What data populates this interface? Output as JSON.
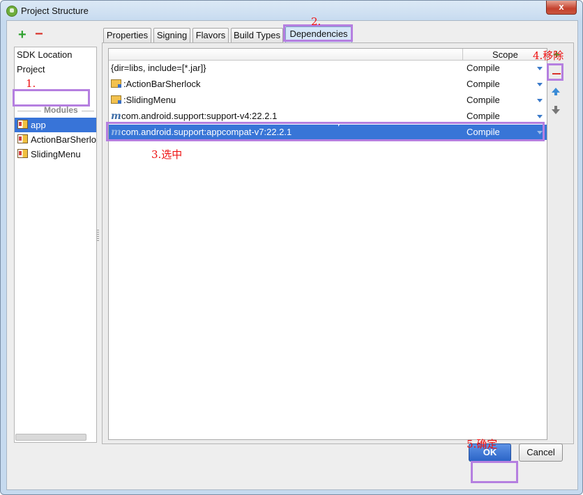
{
  "window": {
    "title": "Project Structure",
    "close_label": "x"
  },
  "left_toolbar": {
    "add_label": "+",
    "remove_label": "−"
  },
  "sidebar": {
    "items": [
      {
        "label": "SDK Location"
      },
      {
        "label": "Project"
      }
    ],
    "modules_header": "Modules",
    "modules": [
      {
        "label": "app",
        "selected": true
      },
      {
        "label": "ActionBarSherlo",
        "selected": false
      },
      {
        "label": "SlidingMenu",
        "selected": false
      }
    ]
  },
  "tabs": [
    {
      "label": "Properties",
      "active": false
    },
    {
      "label": "Signing",
      "active": false
    },
    {
      "label": "Flavors",
      "active": false
    },
    {
      "label": "Build Types",
      "active": false
    },
    {
      "label": "Dependencies",
      "active": true
    }
  ],
  "table": {
    "columns": [
      "",
      "Scope"
    ],
    "rows": [
      {
        "icon": "none",
        "name": "{dir=libs, include=[*.jar]}",
        "scope": "Compile",
        "selected": false
      },
      {
        "icon": "module-folder-icon",
        "name": ":ActionBarSherlock",
        "scope": "Compile",
        "selected": false
      },
      {
        "icon": "module-folder-icon",
        "name": ":SlidingMenu",
        "scope": "Compile",
        "selected": false
      },
      {
        "icon": "maven-library-icon",
        "name": "com.android.support:support-v4:22.2.1",
        "scope": "Compile",
        "selected": false
      },
      {
        "icon": "maven-library-icon",
        "name": "com.android.support:appcompat-v7:22.2.1",
        "scope": "Compile",
        "selected": true
      }
    ]
  },
  "side_tools": {
    "add": "+",
    "remove": "−",
    "move_up": "up-arrow-icon",
    "move_down": "down-arrow-icon"
  },
  "buttons": {
    "ok": "OK",
    "cancel": "Cancel"
  },
  "annotations": {
    "step1": "1.",
    "step2": "2.",
    "step3": "3.选中",
    "step4": "4.移除",
    "step5": "5.确定"
  },
  "colors": {
    "annotation": "#ee1111",
    "highlight": "#b57fe0",
    "selection": "#3875d7"
  }
}
